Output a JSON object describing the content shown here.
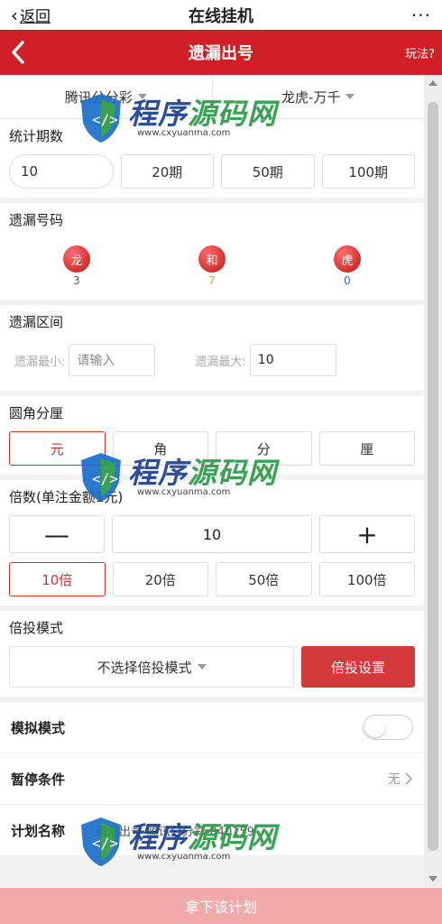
{
  "topbar": {
    "back_label": "返回",
    "title": "在线挂机",
    "more": "···"
  },
  "header": {
    "title": "遗漏出号",
    "rules": "玩法?"
  },
  "selectors": {
    "lottery": "腾讯分分彩",
    "play": "龙虎-万千"
  },
  "period": {
    "title": "统计期数",
    "input_value": "10",
    "options": [
      "20期",
      "50期",
      "100期"
    ]
  },
  "miss_numbers": {
    "title": "遗漏号码",
    "balls": [
      {
        "label": "龙",
        "count": "3",
        "color": "#555555"
      },
      {
        "label": "和",
        "count": "7",
        "color": "#e6a23c"
      },
      {
        "label": "虎",
        "count": "0",
        "color": "#3a68c8"
      }
    ]
  },
  "miss_range": {
    "title": "遗漏区间",
    "min_label": "遗漏最小:",
    "min_placeholder": "请输入",
    "max_label": "遗漏最大:",
    "max_value": "10"
  },
  "unit": {
    "title": "圆角分厘",
    "options": [
      "元",
      "角",
      "分",
      "厘"
    ],
    "selected": "元"
  },
  "multiple": {
    "title": "倍数(单注金额1元)",
    "minus": "—",
    "value": "10",
    "plus": "+",
    "options": [
      "10倍",
      "20倍",
      "50倍",
      "100倍"
    ],
    "selected": "10倍"
  },
  "bet_mode": {
    "title": "倍投模式",
    "select_label": "不选择倍投模式",
    "settings_button": "倍投设置"
  },
  "list": {
    "simulate_label": "模拟模式",
    "pause_label": "暂停条件",
    "pause_value": "无",
    "plan_label": "计划名称",
    "plan_value": "遗漏出号-腾讯分分彩-040159"
  },
  "footer": {
    "submit": "拿下该计划"
  },
  "watermark": {
    "brand_a": "程序",
    "brand_b": "源码网",
    "url": "www.cxyuanma.com"
  },
  "colors": {
    "primary": "#d01f27",
    "button": "#d53a3a",
    "submit": "#f2a9a9"
  }
}
